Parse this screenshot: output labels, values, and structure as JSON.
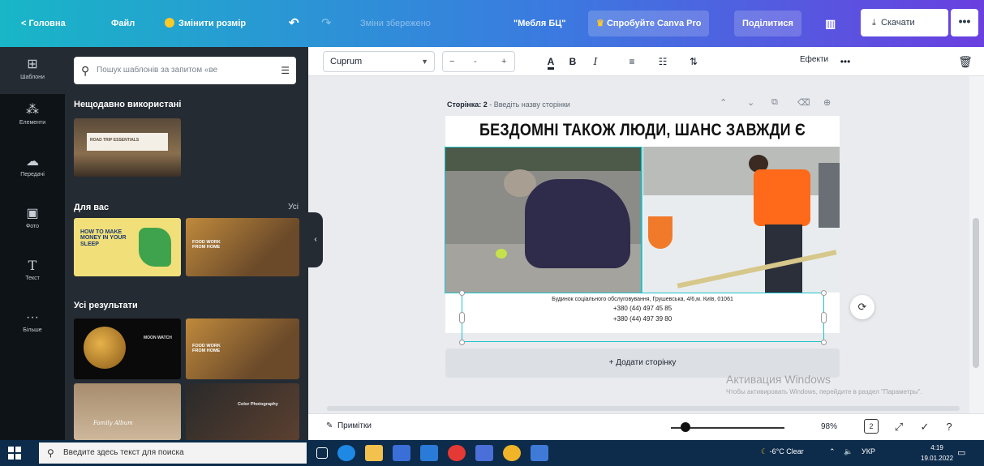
{
  "topbar": {
    "home": "< Головна",
    "file": "Файл",
    "resize": "Змінити розмір",
    "undo_icon": "undo-icon",
    "redo_icon": "redo-icon",
    "save_status": "Зміни збережено",
    "doc_title": "\"Мебля БЦ\"",
    "try_pro": "Спробуйте Canva Pro",
    "share": "Поділитися",
    "download": "Скачати",
    "more": "•••"
  },
  "rail": {
    "items": [
      {
        "icon": "template-icon",
        "label": "Шаблони"
      },
      {
        "icon": "elements-icon",
        "label": "Елементи"
      },
      {
        "icon": "uploads-icon",
        "label": "Передачі"
      },
      {
        "icon": "photos-icon",
        "label": "Фото"
      },
      {
        "icon": "text-icon",
        "label": "Текст"
      },
      {
        "icon": "more-icon",
        "label": "Більше"
      }
    ]
  },
  "panel": {
    "search_placeholder": "Пошук шаблонів за запитом «ве",
    "recent_title": "Нещодавно використані",
    "recent_thumb_text": "ROAD TRIP ESSENTIALS",
    "for_you_title": "Для вас",
    "for_you_all": "Усі",
    "for_you_thumb1": "HOW TO MAKE MONEY IN YOUR SLEEP",
    "for_you_thumb2": "FOOD WORK FROM HOME",
    "results_title": "Усі результати",
    "result_thumb1": "MOON WATCH",
    "result_thumb2": "FOOD WORK FROM HOME",
    "result_thumb3": "Family Album",
    "result_thumb4": "Color Photography"
  },
  "toolbar": {
    "font": "Cuprum",
    "size": "-",
    "bold": "B",
    "italic": "I",
    "effects": "Ефекти",
    "more": "•••"
  },
  "canvas": {
    "page_label_bold": "Сторінка: 2",
    "page_label_rest": " - Введіть назву сторінки",
    "headline": "БЕЗДОМНІ ТАКОЖ ЛЮДИ, ШАНС ЗАВЖДИ Є",
    "info_line1": "Будинок соціального обслуговування, Грушевська, 4/6,м. Київ, 01061",
    "info_line2": "+380 (44) 497 45 85",
    "info_line3": "+380 (44) 497 39 80",
    "add_page": "+ Додати сторінку",
    "watermark_title": "Активация Windows",
    "watermark_text": "Чтобы активировать Windows, перейдите в раздел \"Параметры\"."
  },
  "bottombar": {
    "notes": "Примітки",
    "zoom": "98%",
    "zoom_fraction": 0.13
  },
  "taskbar": {
    "search_placeholder": "Введите здесь текст для поиска",
    "weather": "-6°C Clear",
    "lang": "УКР",
    "time": "4:19",
    "date": "19.01.2022"
  },
  "colors": {
    "accent": "#20c4cb",
    "panel_bg": "#252b33",
    "rail_bg": "#0e1318",
    "taskbar_bg": "#0d2b4a"
  }
}
